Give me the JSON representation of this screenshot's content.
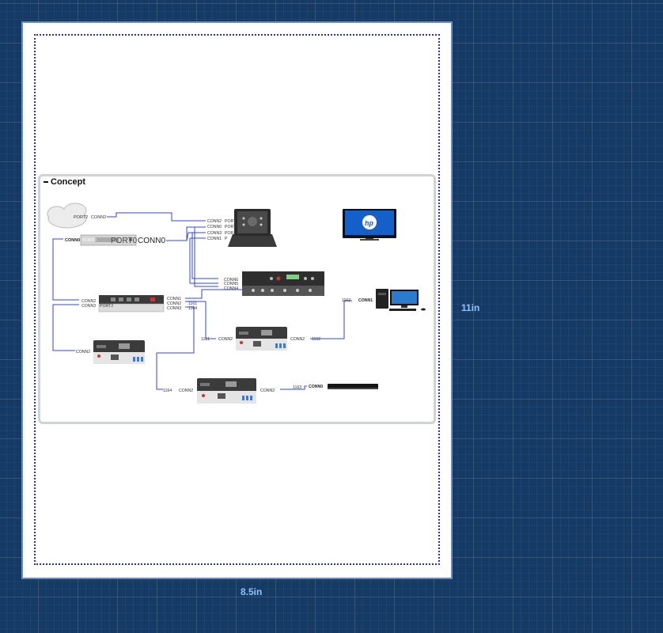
{
  "page": {
    "width_label": "8.5in",
    "height_label": "11in"
  },
  "group": {
    "title": "Concept"
  },
  "labels": {
    "cloud_port": "PORT2",
    "cloud_conn": "CONN2",
    "rack_conn": "CONN0",
    "rack_port_left": "PORT0",
    "rack_port_right": "PORT0",
    "rack_conn_right": "CONN0",
    "touchpanel_conns": [
      "CONN2",
      "CONN0",
      "CONN3",
      "CONN1"
    ],
    "touchpanel_ports": [
      "PORT",
      "PORT",
      "POR",
      "P"
    ],
    "switcher_conns": [
      "CONN6",
      "CONN5",
      "CONN4"
    ],
    "matrix_left_conns": [
      "CONN2",
      "CONN3"
    ],
    "matrix_left_port": "PORT2",
    "matrix_right_conns": [
      "CONN1",
      "CONN2",
      "CONN3"
    ],
    "matrix_right_ids": [
      "1161",
      "1164"
    ],
    "box1_conn": "CONN2",
    "box2_in": "1161",
    "box2_conn_left": "CONN2",
    "box2_conn_right": "CONN2",
    "box2_out": "1162",
    "pc_in": "1162",
    "pc_conn": "CONN1",
    "box3_in": "1164",
    "box3_conn_left": "CONN2",
    "box3_conn_right": "CONN2",
    "box3_out": "1163",
    "bluray_in": "1163",
    "bluray_conn": "CONN0"
  },
  "icons": [
    "cloud-icon",
    "touch-panel-icon",
    "monitor-icon",
    "rack-device-icon",
    "switcher-icon",
    "matrix-switcher-icon",
    "extender-box-icon",
    "desktop-pc-icon",
    "bluray-player-icon"
  ],
  "colors": {
    "link": "#3344dd",
    "grid": "#163a66",
    "page_border": "#6c8fbf",
    "monitor_screen": "#1560c8"
  }
}
